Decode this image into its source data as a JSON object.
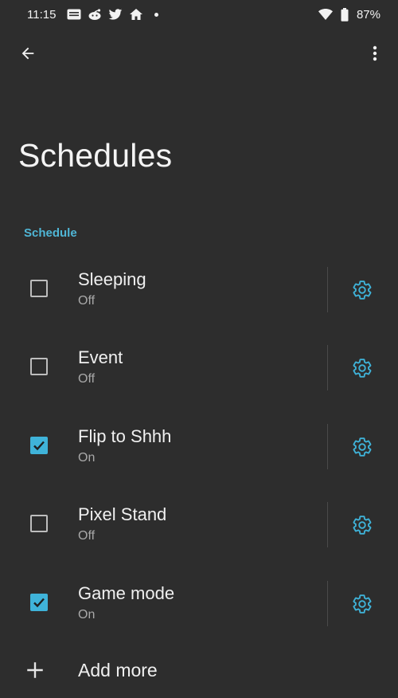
{
  "status_bar": {
    "time": "11:15",
    "battery": "87%",
    "icons": [
      "news-icon",
      "reddit-icon",
      "twitter-icon",
      "home-icon",
      "dot-icon",
      "wifi-icon",
      "battery-icon"
    ]
  },
  "app_bar": {
    "back_icon": "back-arrow-icon",
    "more_icon": "more-vert-icon"
  },
  "page": {
    "title": "Schedules",
    "section_header": "Schedule"
  },
  "schedules": [
    {
      "label": "Sleeping",
      "status": "Off",
      "checked": false
    },
    {
      "label": "Event",
      "status": "Off",
      "checked": false
    },
    {
      "label": "Flip to Shhh",
      "status": "On",
      "checked": true
    },
    {
      "label": "Pixel Stand",
      "status": "Off",
      "checked": false
    },
    {
      "label": "Game mode",
      "status": "On",
      "checked": true
    }
  ],
  "add_more": {
    "label": "Add more",
    "icon": "plus-icon"
  },
  "colors": {
    "background": "#2d2d2d",
    "accent": "#3fb3d9",
    "section_header": "#4fb6d6",
    "secondary_text": "#a9a9a9"
  }
}
